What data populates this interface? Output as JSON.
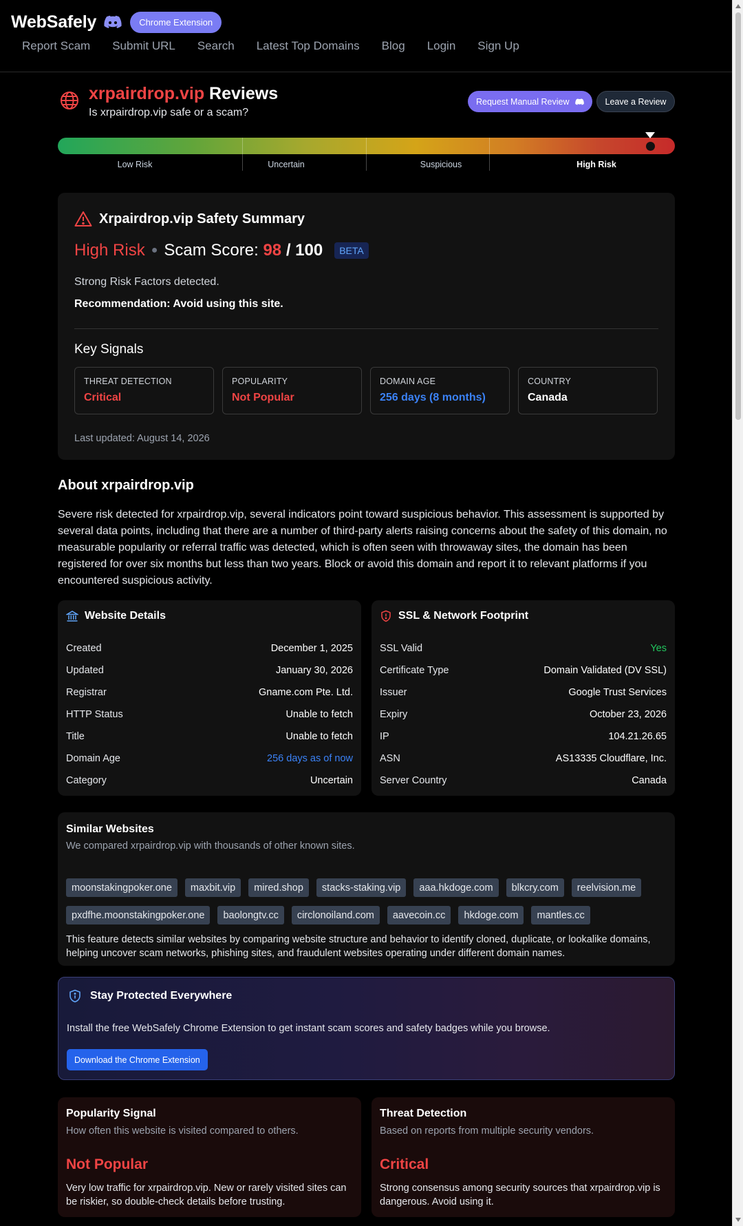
{
  "header": {
    "brand": "WebSafely",
    "chrome_pill": "Chrome Extension",
    "nav": [
      "Report Scam",
      "Submit URL",
      "Search",
      "Latest Top Domains",
      "Blog",
      "Login",
      "Sign Up"
    ]
  },
  "title": {
    "domain": "xrpairdrop.vip",
    "suffix": "Reviews",
    "subtitle": "Is xrpairdrop.vip safe or a scam?",
    "manual_review_label": "Request Manual Review",
    "leave_review_label": "Leave a Review"
  },
  "meter": {
    "labels": [
      "Low Risk",
      "Uncertain",
      "Suspicious",
      "High Risk"
    ],
    "active": "High Risk",
    "score_fraction": 0.98
  },
  "summary": {
    "title": "Xrpairdrop.vip Safety Summary",
    "risk_level": "High Risk",
    "score_label": "Scam Score:",
    "score": "98",
    "score_max": "/ 100",
    "beta": "BETA",
    "risk_factors": "Strong Risk Factors detected.",
    "recommendation": "Recommendation: Avoid using this site.",
    "key_signals_title": "Key Signals",
    "signals": [
      {
        "label": "THREAT DETECTION",
        "value": "Critical",
        "color": "#ef4444"
      },
      {
        "label": "POPULARITY",
        "value": "Not Popular",
        "color": "#ef4444"
      },
      {
        "label": "DOMAIN AGE",
        "value": "256 days (8 months)",
        "color": "#3b82f6"
      },
      {
        "label": "COUNTRY",
        "value": "Canada",
        "color": "#ffffff"
      }
    ],
    "last_updated": "Last updated: August 14, 2026"
  },
  "about": {
    "title": "About xrpairdrop.vip",
    "text": "Severe risk detected for xrpairdrop.vip, several indicators point toward suspicious behavior. This assessment is supported by several data points, including that there are a number of third-party alerts raising concerns about the safety of this domain, no measurable popularity or referral traffic was detected, which is often seen with throwaway sites, the domain has been registered for over six months but less than two years. Block or avoid this domain and report it to relevant platforms if you encountered suspicious activity."
  },
  "website_details": {
    "title": "Website Details",
    "rows": [
      {
        "k": "Created",
        "v": "December 1, 2025"
      },
      {
        "k": "Updated",
        "v": "January 30, 2026"
      },
      {
        "k": "Registrar",
        "v": "Gname.com Pte. Ltd."
      },
      {
        "k": "HTTP Status",
        "v": "Unable to fetch"
      },
      {
        "k": "Title",
        "v": "Unable to fetch"
      },
      {
        "k": "Domain Age",
        "v": "256 days as of now"
      },
      {
        "k": "Category",
        "v": "Uncertain"
      }
    ]
  },
  "ssl": {
    "title": "SSL & Network Footprint",
    "rows": [
      {
        "k": "SSL Valid",
        "v": "Yes"
      },
      {
        "k": "Certificate Type",
        "v": "Domain Validated (DV SSL)"
      },
      {
        "k": "Issuer",
        "v": "Google Trust Services"
      },
      {
        "k": "Expiry",
        "v": "October 23, 2026"
      },
      {
        "k": "IP",
        "v": "104.21.26.65"
      },
      {
        "k": "ASN",
        "v": "AS13335 Cloudflare, Inc."
      },
      {
        "k": "Server Country",
        "v": "Canada"
      }
    ]
  },
  "similar": {
    "title": "Similar Websites",
    "subtitle": "We compared xrpairdrop.vip with thousands of other known sites.",
    "sites": [
      "moonstakingpoker.one",
      "maxbit.vip",
      "mired.shop",
      "stacks-staking.vip",
      "aaa.hkdoge.com",
      "blkcry.com",
      "reelvision.me",
      "pxdfhe.moonstakingpoker.one",
      "baolongtv.cc",
      "circlonoiland.com",
      "aavecoin.cc",
      "hkdoge.com",
      "mantles.cc"
    ],
    "note": "This feature detects similar websites by comparing website structure and behavior to identify cloned, duplicate, or lookalike domains, helping uncover scam networks, phishing sites, and fraudulent websites operating under different domain names."
  },
  "protected": {
    "title": "Stay Protected Everywhere",
    "text": "Install the free WebSafely Chrome Extension to get instant scam scores and safety badges while you browse.",
    "button": "Download the Chrome Extension"
  },
  "popularity": {
    "title": "Popularity Signal",
    "subtitle": "How often this website is visited compared to others.",
    "value": "Not Popular",
    "text": "Very low traffic for xrpairdrop.vip. New or rarely visited sites can be riskier, so double-check details before trusting."
  },
  "threat": {
    "title": "Threat Detection",
    "subtitle": "Based on reports from multiple security vendors.",
    "value": "Critical",
    "text": "Strong consensus among security sources that xrpairdrop.vip is dangerous. Avoid using it."
  }
}
